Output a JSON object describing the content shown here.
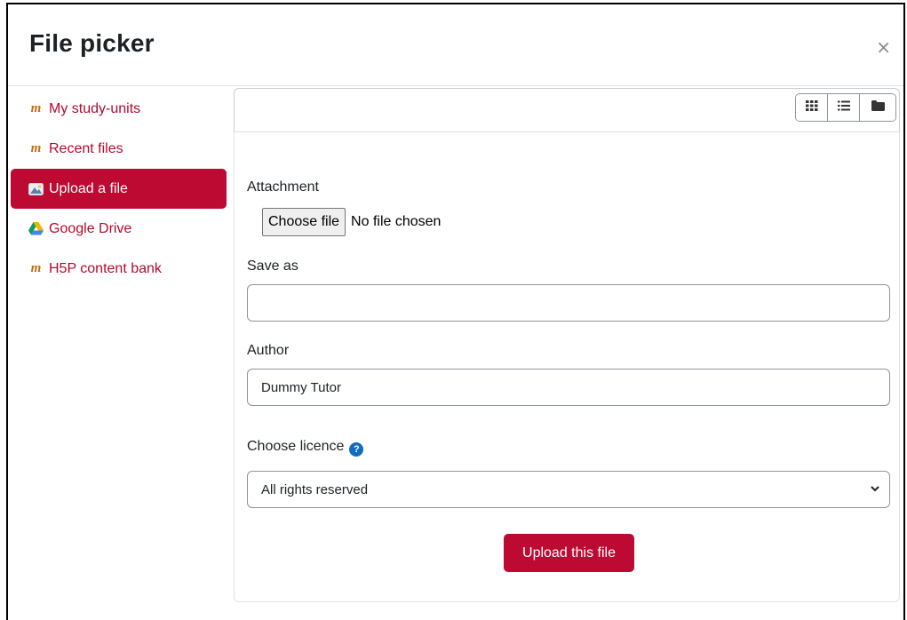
{
  "dialog": {
    "title": "File picker",
    "close_glyph": "×"
  },
  "sidebar": {
    "items": [
      {
        "label": "My study-units",
        "icon": "moodle-icon",
        "active": false
      },
      {
        "label": "Recent files",
        "icon": "moodle-icon",
        "active": false
      },
      {
        "label": "Upload a file",
        "icon": "upload-icon",
        "active": true
      },
      {
        "label": "Google Drive",
        "icon": "google-drive-icon",
        "active": false
      },
      {
        "label": "H5P content bank",
        "icon": "moodle-icon",
        "active": false
      }
    ]
  },
  "toolbar": {
    "views": [
      "icons-view",
      "list-view",
      "tree-view"
    ]
  },
  "form": {
    "attachment_label": "Attachment",
    "choose_file_label": "Choose file",
    "no_file_text": "No file chosen",
    "save_as_label": "Save as",
    "save_as_value": "",
    "author_label": "Author",
    "author_value": "Dummy Tutor",
    "licence_label": "Choose licence",
    "licence_value": "All rights reserved",
    "upload_button": "Upload this file"
  },
  "colors": {
    "accent": "#bd0a33",
    "link": "#b40a2d",
    "help": "#0f6cbf"
  }
}
